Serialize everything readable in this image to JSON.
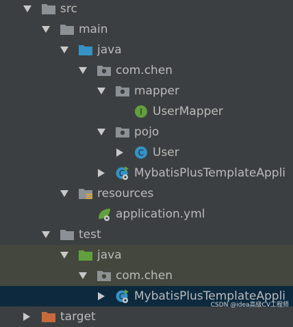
{
  "tree": {
    "src": "src",
    "main": "main",
    "main_java": "java",
    "com_chen": "com.chen",
    "mapper": "mapper",
    "user_mapper": "UserMapper",
    "pojo": "pojo",
    "user": "User",
    "app_main": "MybatisPlusTemplateAppli",
    "resources": "resources",
    "application_yml": "application.yml",
    "test": "test",
    "test_java": "java",
    "test_com_chen": "com.chen",
    "app_test": "MybatisPlusTemplateAppli",
    "target": "target"
  },
  "watermark": "CSDN @idea高级CV工程师",
  "colors": {
    "panel_bg": "#3c3f41",
    "selected_bg": "#0d293e",
    "test_bg": "#44473d",
    "text": "#bbbbbb",
    "folder_grey": "#8c9196",
    "folder_blue": "#3592c4",
    "folder_green": "#62a03e",
    "class_icon": "#3592c4",
    "interface_icon": "#62a03e"
  },
  "icons": {
    "src": "folder-icon",
    "main": "folder-icon",
    "main_java": "source-folder-icon",
    "package": "package-icon",
    "class": "class-icon",
    "interface": "interface-icon",
    "spring_boot_app": "spring-boot-app-icon",
    "resources": "resources-folder-icon",
    "yml": "spring-yml-icon",
    "test_java": "test-source-folder-icon"
  }
}
